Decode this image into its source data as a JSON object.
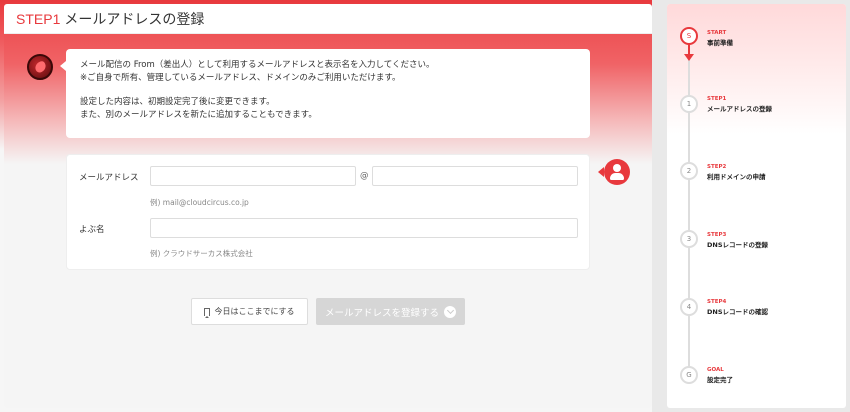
{
  "header": {
    "step_label": "STEP1",
    "title": "メールアドレスの登録"
  },
  "message": {
    "line1": "メール配信の From（差出人）として利用するメールアドレスと表示名を入力してください。",
    "line2": "※ご自身で所有、管理しているメールアドレス、ドメインのみご利用いただけます。",
    "line3": "設定した内容は、初期設定完了後に変更できます。",
    "line4": "また、別のメールアドレスを新たに追加することもできます。"
  },
  "form": {
    "email_label": "メールアドレス",
    "email_local_value": "",
    "at_symbol": "@",
    "email_domain_value": "",
    "email_hint": "例) mail@cloudcircus.co.jp",
    "name_label": "よぶ名",
    "name_value": "",
    "name_hint": "例) クラウドサーカス株式会社"
  },
  "actions": {
    "later_label": "今日はここまでにする",
    "register_label": "メールアドレスを登録する"
  },
  "sidebar": {
    "steps": [
      {
        "marker": "S",
        "step": "START",
        "name": "事前準備",
        "active": true
      },
      {
        "marker": "1",
        "step": "STEP1",
        "name": "メールアドレスの登録",
        "active": false
      },
      {
        "marker": "2",
        "step": "STEP2",
        "name": "利用ドメインの申請",
        "active": false
      },
      {
        "marker": "3",
        "step": "STEP3",
        "name": "DNSレコードの登録",
        "active": false
      },
      {
        "marker": "4",
        "step": "STEP4",
        "name": "DNSレコードの確認",
        "active": false
      },
      {
        "marker": "G",
        "step": "GOAL",
        "name": "設定完了",
        "active": false
      }
    ]
  },
  "colors": {
    "accent": "#e8393d",
    "disabled": "#d6d6d6"
  },
  "icons": {
    "bot": "bird-avatar-icon",
    "user": "user-avatar-icon",
    "later": "bookmark-icon",
    "register": "chevron-down-circle-icon"
  }
}
